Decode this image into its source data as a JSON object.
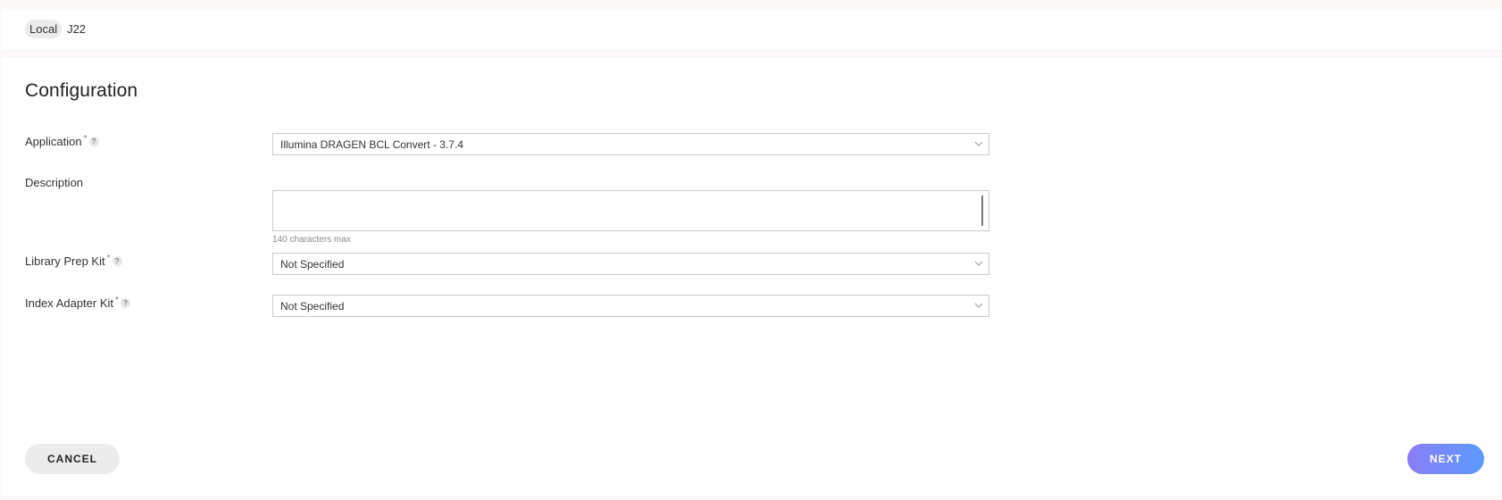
{
  "header": {
    "location_chip": "Local",
    "run_name": "J22"
  },
  "page": {
    "title": "Configuration"
  },
  "form": {
    "application": {
      "label": "Application",
      "required_mark": "*",
      "help": "?",
      "value": "Illumina DRAGEN BCL Convert - 3.7.4"
    },
    "description": {
      "label": "Description",
      "value": "",
      "hint": "140 characters max"
    },
    "library_prep_kit": {
      "label": "Library Prep Kit",
      "required_mark": "*",
      "help": "?",
      "value": "Not Specified"
    },
    "index_adapter_kit": {
      "label": "Index Adapter Kit",
      "required_mark": "*",
      "help": "?",
      "value": "Not Specified"
    }
  },
  "footer": {
    "cancel_label": "CANCEL",
    "next_label": "NEXT"
  },
  "icons": {
    "dropdown": "chevron-down-icon",
    "help": "question-mark-icon"
  },
  "colors": {
    "next_gradient_start": "#8a7cf6",
    "next_gradient_end": "#5a9bff",
    "cancel_bg": "#ebebeb"
  }
}
